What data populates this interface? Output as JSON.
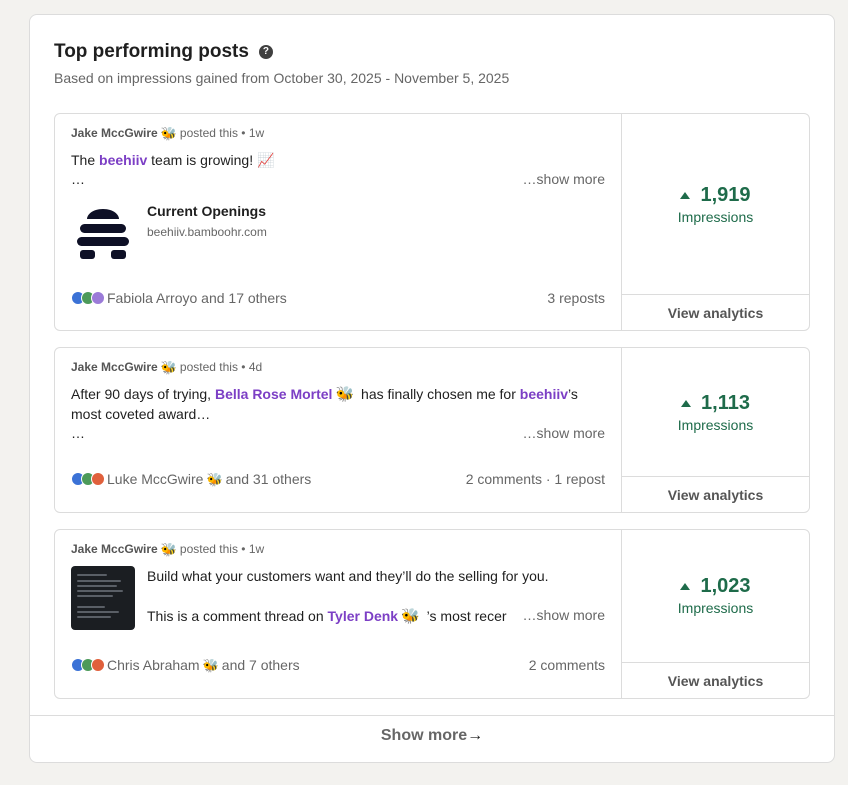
{
  "header": {
    "title": "Top performing posts",
    "subtitle": "Based on impressions gained from October 30, 2025 - November 5, 2025"
  },
  "colors": {
    "accent_purple": "#7c3fc5",
    "impressions_green": "#1e6b4a"
  },
  "posts": [
    {
      "author": "Jake MccGwire",
      "posted_suffix": "posted this",
      "age": "• 1w",
      "line1_pre": "The ",
      "line1_mention": "beehiiv",
      "line1_post": " team is growing! 📈",
      "ellipsis": "…",
      "show_more": "…show more",
      "link_title": "Current Openings",
      "link_url": "beehiiv.bamboohr.com",
      "reactions_text": "Fabiola Arroyo and 17 others",
      "counts": "3 reposts",
      "impressions": "1,919",
      "impressions_label": "Impressions",
      "analytics_label": "View analytics"
    },
    {
      "author": "Jake MccGwire",
      "posted_suffix": "posted this",
      "age": "• 4d",
      "line1_pre": "After 90 days of trying, ",
      "line1_mention": "Bella Rose Mortel",
      "line1_mid": " has finally chosen me for ",
      "line1_mention2": "beehiiv",
      "line1_post": "’s",
      "line2": "most coveted award…",
      "ellipsis": "…",
      "show_more": "…show more",
      "reactions_name": "Luke MccGwire",
      "reactions_rest": "and 31 others",
      "counts": "2 comments · 1 repost",
      "impressions": "1,113",
      "impressions_label": "Impressions",
      "analytics_label": "View analytics"
    },
    {
      "author": "Jake MccGwire",
      "posted_suffix": "posted this",
      "age": "• 1w",
      "line1": "Build what your customers want and they’ll do the selling for you.",
      "line2_pre": "This is a comment thread on ",
      "line2_mention": "Tyler Denk",
      "line2_post": " ’s most recer",
      "show_more": "…show more",
      "reactions_name": "Chris Abraham",
      "reactions_rest": "and 7 others",
      "counts": "2 comments",
      "impressions": "1,023",
      "impressions_label": "Impressions",
      "analytics_label": "View analytics"
    }
  ],
  "footer": {
    "show_more": "Show more",
    "arrow": "→"
  },
  "icons": {
    "help": "question-circle-icon",
    "bee": "bee-emoji-icon",
    "trend": "up-triangle-icon",
    "reactions": [
      "like-reaction-icon",
      "support-reaction-icon",
      "celebrate-reaction-icon",
      "love-reaction-icon"
    ]
  }
}
